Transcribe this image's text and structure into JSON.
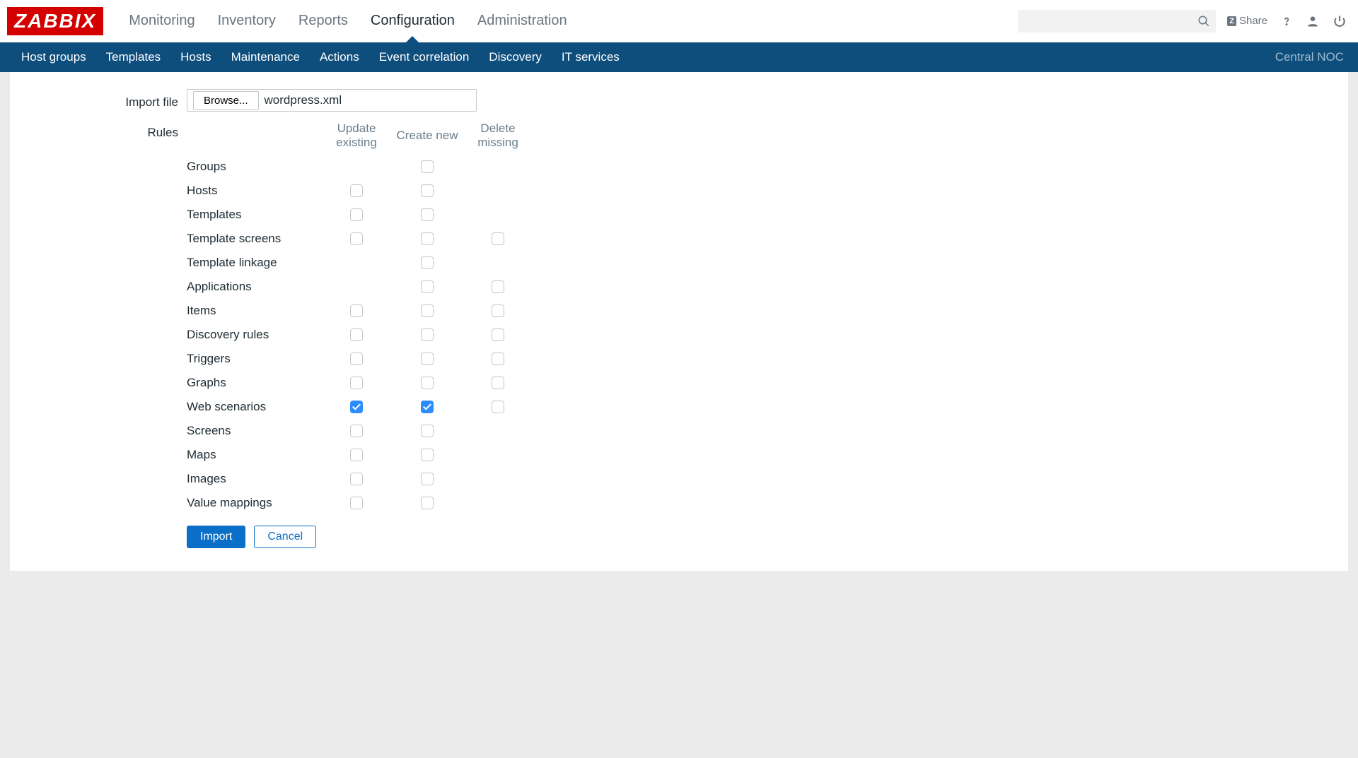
{
  "logo": "ZABBIX",
  "mainnav": {
    "items": [
      {
        "label": "Monitoring"
      },
      {
        "label": "Inventory"
      },
      {
        "label": "Reports"
      },
      {
        "label": "Configuration",
        "active": true
      },
      {
        "label": "Administration"
      }
    ]
  },
  "search": {
    "placeholder": ""
  },
  "share": {
    "label": "Share"
  },
  "subnav": {
    "items": [
      {
        "label": "Host groups"
      },
      {
        "label": "Templates"
      },
      {
        "label": "Hosts"
      },
      {
        "label": "Maintenance"
      },
      {
        "label": "Actions"
      },
      {
        "label": "Event correlation"
      },
      {
        "label": "Discovery"
      },
      {
        "label": "IT services"
      }
    ],
    "right": "Central NOC"
  },
  "form": {
    "import_file_label": "Import file",
    "browse_label": "Browse...",
    "file_name": "wordpress.xml",
    "rules_label": "Rules",
    "columns": {
      "update": "Update existing",
      "create": "Create new",
      "delete": "Delete missing"
    },
    "rows": [
      {
        "label": "Groups",
        "update": null,
        "create": false,
        "delete": null
      },
      {
        "label": "Hosts",
        "update": false,
        "create": false,
        "delete": null
      },
      {
        "label": "Templates",
        "update": false,
        "create": false,
        "delete": null
      },
      {
        "label": "Template screens",
        "update": false,
        "create": false,
        "delete": false
      },
      {
        "label": "Template linkage",
        "update": null,
        "create": false,
        "delete": null
      },
      {
        "label": "Applications",
        "update": null,
        "create": false,
        "delete": false
      },
      {
        "label": "Items",
        "update": false,
        "create": false,
        "delete": false
      },
      {
        "label": "Discovery rules",
        "update": false,
        "create": false,
        "delete": false
      },
      {
        "label": "Triggers",
        "update": false,
        "create": false,
        "delete": false
      },
      {
        "label": "Graphs",
        "update": false,
        "create": false,
        "delete": false
      },
      {
        "label": "Web scenarios",
        "update": true,
        "create": true,
        "delete": false
      },
      {
        "label": "Screens",
        "update": false,
        "create": false,
        "delete": null
      },
      {
        "label": "Maps",
        "update": false,
        "create": false,
        "delete": null
      },
      {
        "label": "Images",
        "update": false,
        "create": false,
        "delete": null
      },
      {
        "label": "Value mappings",
        "update": false,
        "create": false,
        "delete": null
      }
    ],
    "buttons": {
      "import": "Import",
      "cancel": "Cancel"
    }
  }
}
